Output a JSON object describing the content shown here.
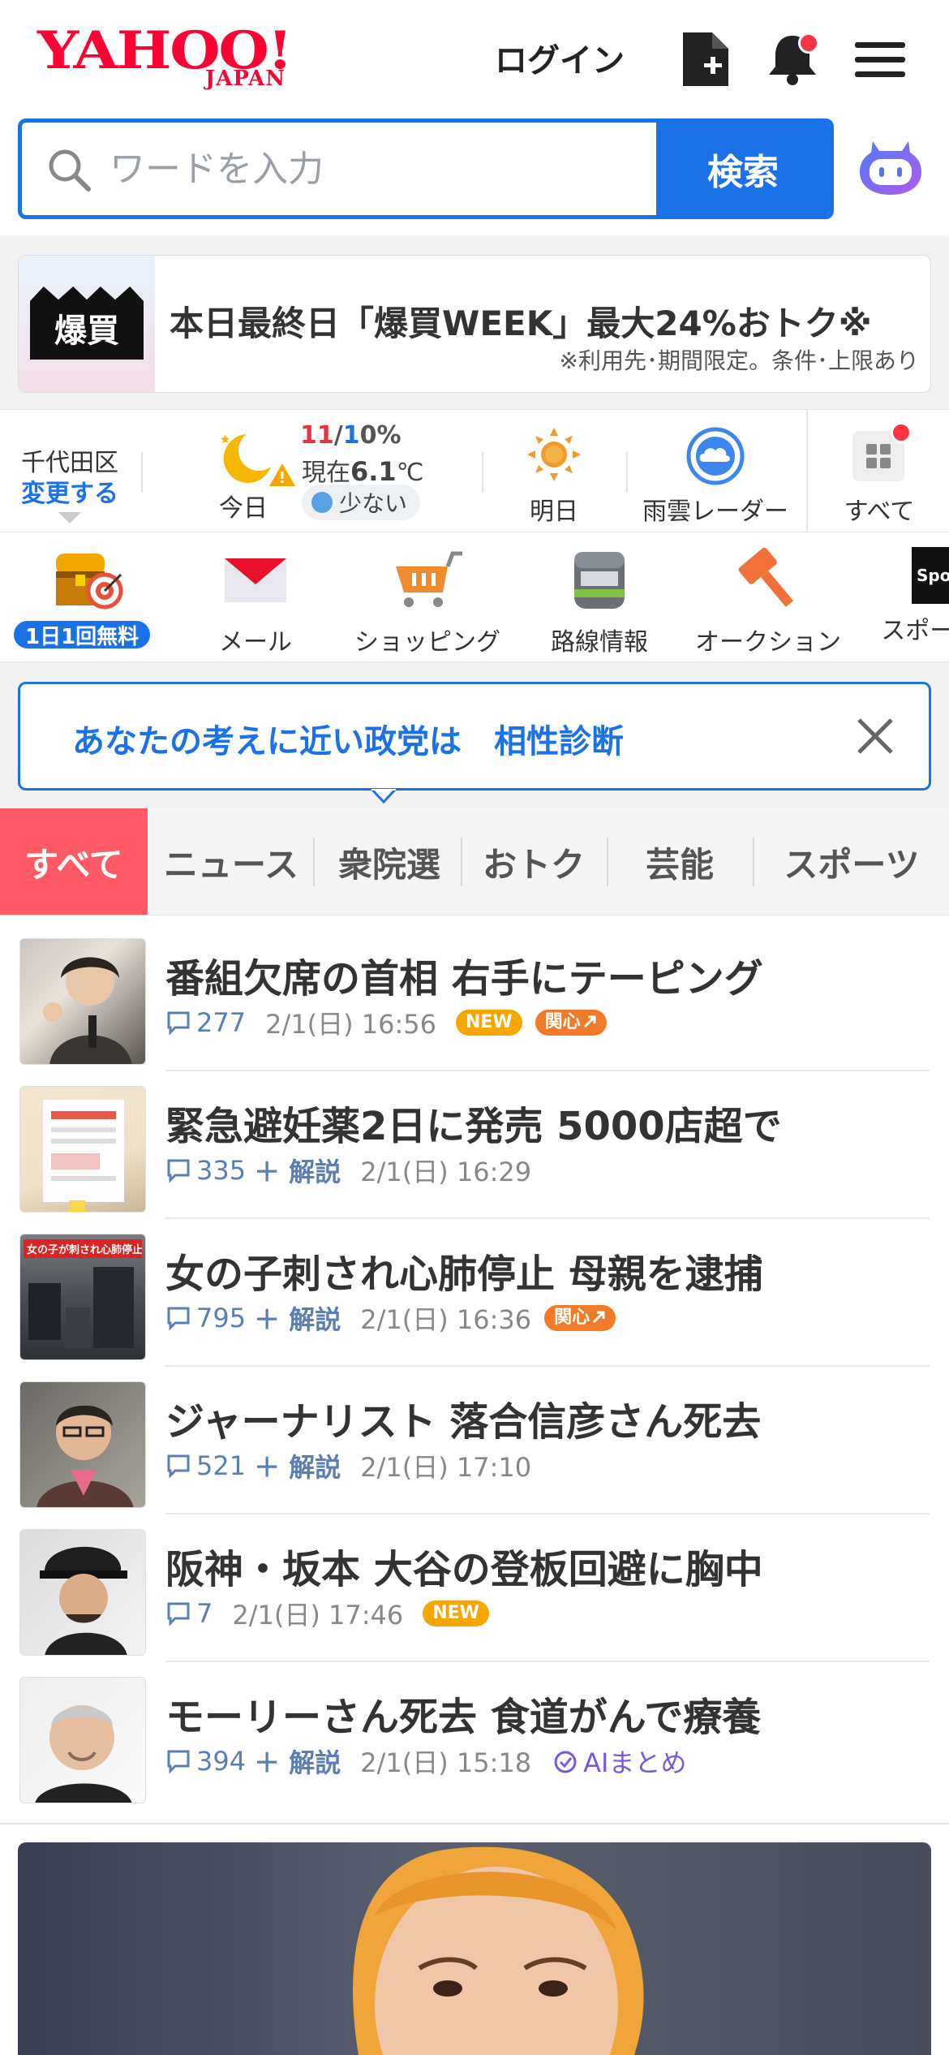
{
  "header": {
    "logo_main": "YAHOO!",
    "logo_sub": "JAPAN",
    "login_label": "ログイン",
    "icons": [
      "doc-add-icon",
      "bell-icon",
      "menu-icon"
    ]
  },
  "search": {
    "placeholder": "ワードを入力",
    "button_label": "検索"
  },
  "banner": {
    "image_text": "爆買",
    "title": "本日最終日「爆買WEEK」最大24%おトク※",
    "note": "※利用先･期間限定。条件･上限あり"
  },
  "weather": {
    "location": "千代田区",
    "change_label": "変更する",
    "today_label": "今日",
    "temp_high": "11",
    "temp_sep": "/",
    "temp_low": "1",
    "precip": "0%",
    "now_prefix": "現在",
    "now_temp": "6.1",
    "now_unit": "℃",
    "pollen": "少ない",
    "tomorrow_label": "明日",
    "radar_label": "雨雲レーダー",
    "all_label": "すべて"
  },
  "services": [
    {
      "label": "1日1回無料",
      "icon": "treasure-icon"
    },
    {
      "label": "メール",
      "icon": "mail-icon"
    },
    {
      "label": "ショッピング",
      "icon": "cart-icon"
    },
    {
      "label": "路線情報",
      "icon": "train-icon"
    },
    {
      "label": "オークション",
      "icon": "auction-hammer-icon"
    },
    {
      "label": "スポーツ",
      "icon": "sports-icon"
    }
  ],
  "recommend": {
    "text": "あなたの考えに近い政党は　相性診断"
  },
  "tabs": [
    "すべて",
    "ニュース",
    "衆院選",
    "おトク",
    "芸能",
    "スポーツ"
  ],
  "news": [
    {
      "title": "番組欠席の首相 右手にテーピング",
      "comments": "277",
      "explain": "",
      "time": "2/1(日) 16:56",
      "new": "NEW",
      "kanshin": "関心"
    },
    {
      "title": "緊急避妊薬2日に発売 5000店超で",
      "comments": "335",
      "explain": "＋ 解説",
      "time": "2/1(日) 16:29"
    },
    {
      "title": "女の子刺され心肺停止 母親を逮捕",
      "comments": "795",
      "explain": "＋ 解説",
      "time": "2/1(日) 16:36",
      "kanshin": "関心"
    },
    {
      "title": "ジャーナリスト 落合信彦さん死去",
      "comments": "521",
      "explain": "＋ 解説",
      "time": "2/1(日) 17:10"
    },
    {
      "title": "阪神・坂本 大谷の登板回避に胸中",
      "comments": "7",
      "explain": "",
      "time": "2/1(日) 17:46",
      "new": "NEW"
    },
    {
      "title": "モーリーさん死去 食道がんで療養",
      "comments": "394",
      "explain": "＋ 解説",
      "time": "2/1(日) 15:18",
      "ai": "AIまとめ"
    }
  ],
  "thumb_text": {
    "n3": "女の子が刺され心肺停止"
  }
}
